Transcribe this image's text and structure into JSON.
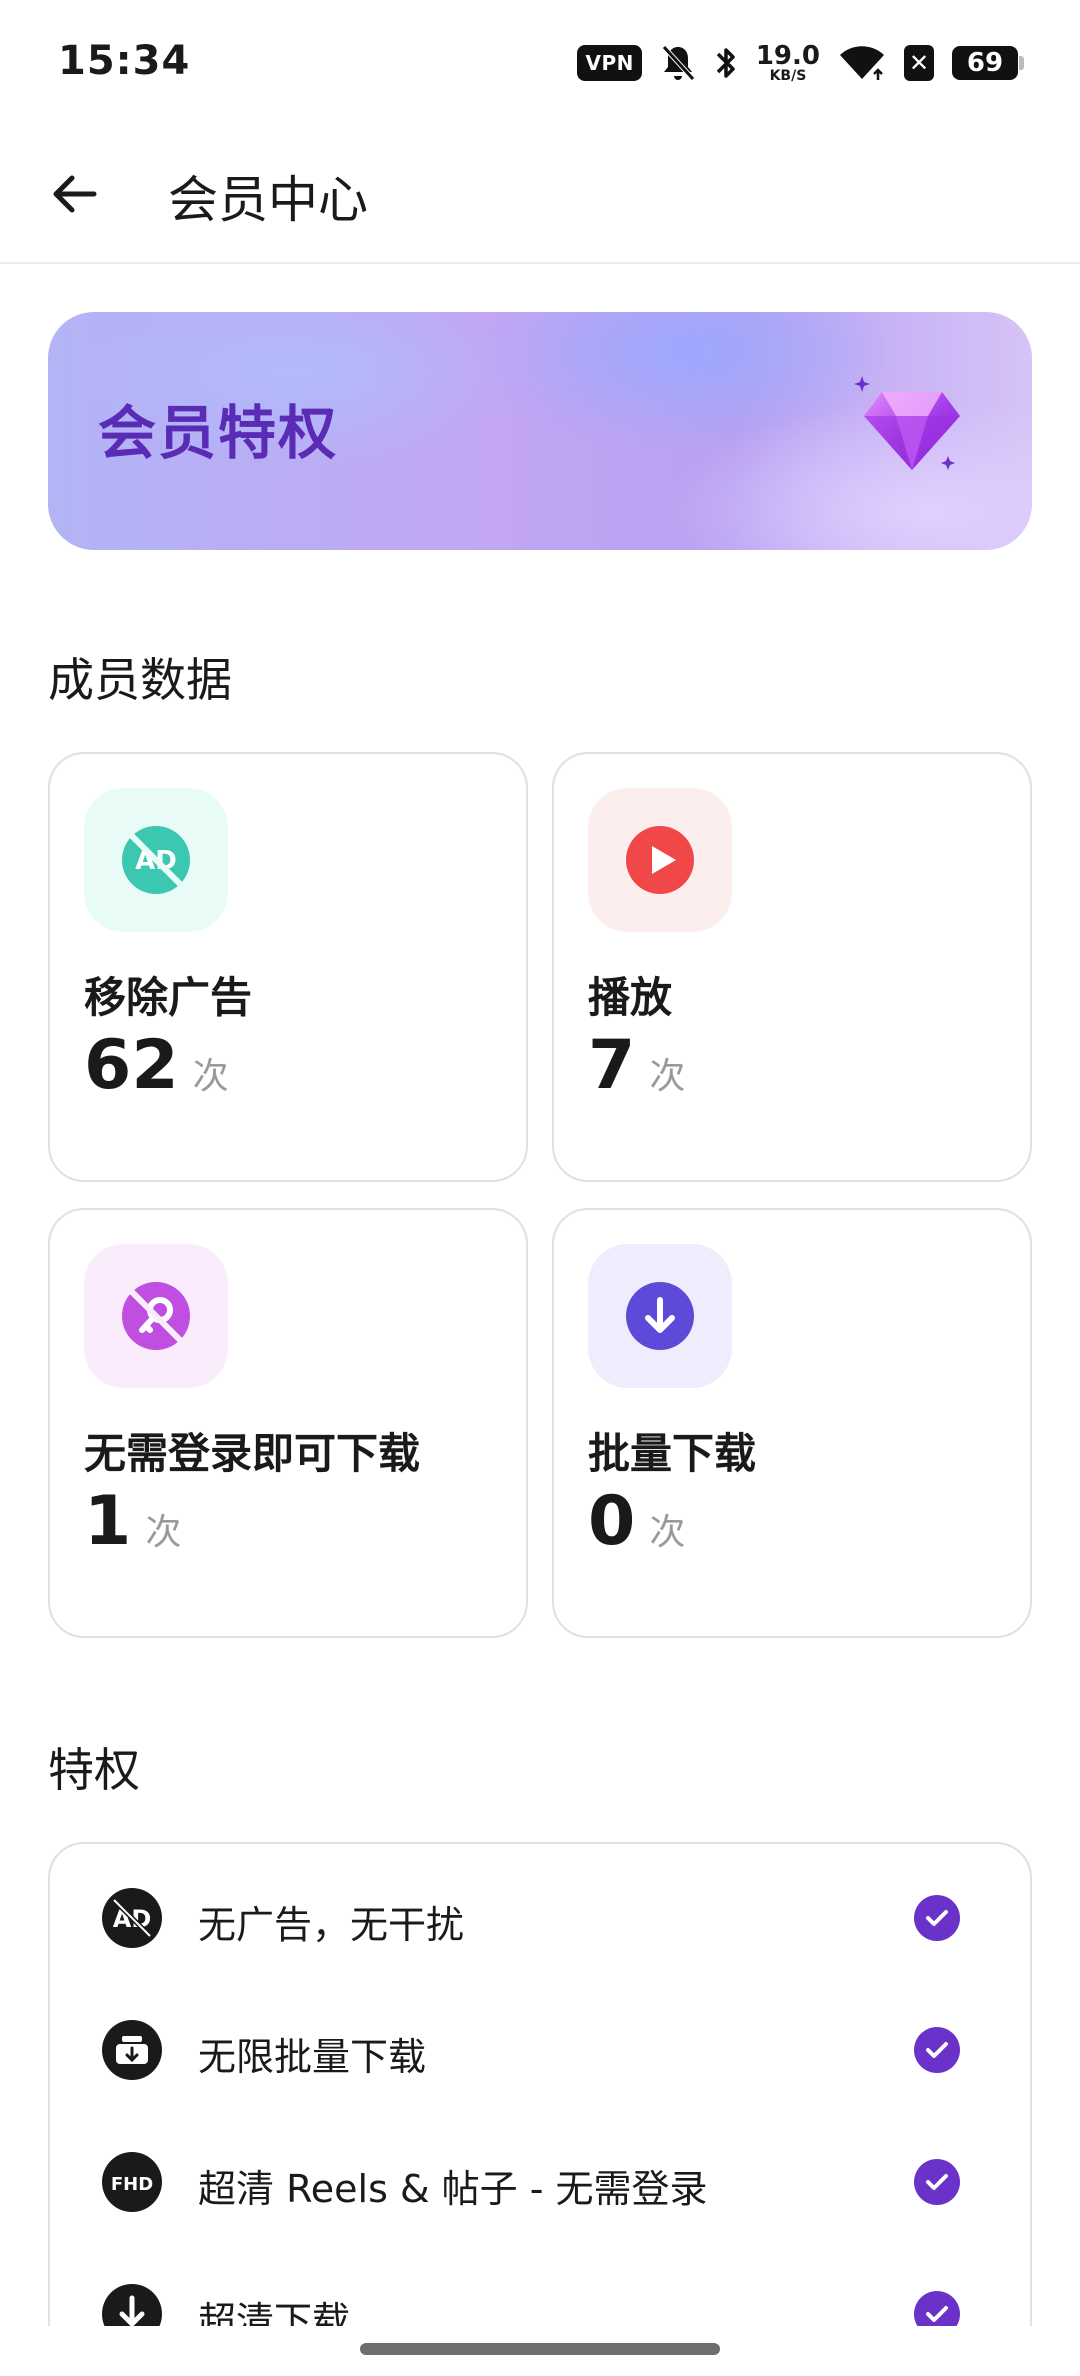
{
  "status_bar": {
    "time": "15:34",
    "vpn": "VPN",
    "net_speed_value": "19.0",
    "net_speed_unit": "KB/S",
    "battery": "69"
  },
  "app_bar": {
    "title": "会员中心"
  },
  "banner": {
    "title": "会员特权"
  },
  "stats_section": {
    "title": "成员数据",
    "cards": [
      {
        "label": "移除广告",
        "value": "62",
        "unit": "次",
        "icon": "ad-block-icon",
        "icon_color": "#3cc8b0"
      },
      {
        "label": "播放",
        "value": "7",
        "unit": "次",
        "icon": "play-icon",
        "icon_color": "#f04848"
      },
      {
        "label": "无需登录即可下载",
        "value": "1",
        "unit": "次",
        "icon": "no-login-key-icon",
        "icon_color": "#c04ee0"
      },
      {
        "label": "批量下载",
        "value": "0",
        "unit": "次",
        "icon": "download-arrow-icon",
        "icon_color": "#5e4ad8"
      }
    ]
  },
  "privileges_section": {
    "title": "特权",
    "items": [
      {
        "label": "无广告，无干扰",
        "icon": "ad-block-icon"
      },
      {
        "label": "无限批量下载",
        "icon": "batch-download-icon"
      },
      {
        "label": "超清 Reels & 帖子 - 无需登录",
        "icon": "fhd-icon"
      },
      {
        "label": "超清下载",
        "icon": "hd-download-icon"
      }
    ]
  },
  "colors": {
    "accent": "#6a32c9",
    "banner_text": "#5a2bb5"
  }
}
